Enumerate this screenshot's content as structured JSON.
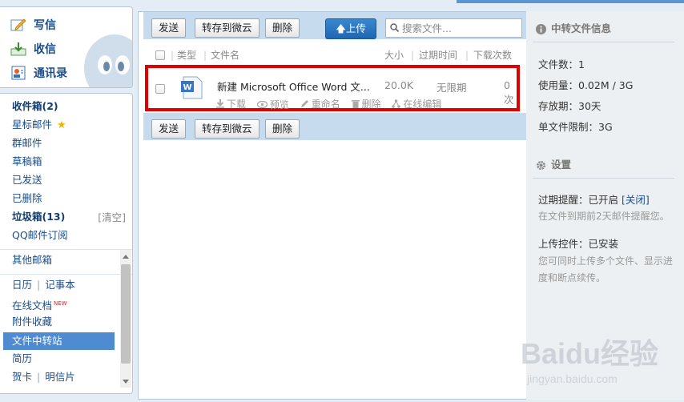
{
  "sidebar": {
    "write": "写信",
    "receive": "收信",
    "contacts": "通讯录",
    "inbox": "收件箱(2)",
    "starred": "星标邮件",
    "group": "群邮件",
    "drafts": "草稿箱",
    "sent": "已发送",
    "deleted": "已删除",
    "trash": "垃圾箱(13)",
    "clear": "[清空]",
    "subscription": "QQ邮件订阅",
    "other": "其他邮箱",
    "calendar": "日历",
    "notes": "记事本",
    "docs": "在线文档",
    "docs_badge": "NEW",
    "attachments": "附件收藏",
    "file_transfer": "文件中转站",
    "resume": "简历",
    "greeting": "贺卡",
    "postcard": "明信片"
  },
  "toolbar": {
    "send": "发送",
    "save_weiyun": "转存到微云",
    "delete": "删除",
    "upload": "上传",
    "search_placeholder": "搜索文件..."
  },
  "columns": {
    "type": "类型",
    "name": "文件名",
    "size": "大小",
    "expiry": "过期时间",
    "downloads": "下载次数"
  },
  "file": {
    "name": "新建 Microsoft Office Word 文...",
    "size": "20.0K",
    "expiry": "无限期",
    "downloads": "0次",
    "actions": {
      "download": "下载",
      "preview": "预览",
      "rename": "重命名",
      "delete": "删除",
      "edit_online": "在线编辑"
    }
  },
  "info": {
    "title": "中转文件信息",
    "file_count": "文件数：1",
    "usage": "使用量：0.02M / 3G",
    "storage": "存放期：30天",
    "limit": "单文件限制：3G",
    "settings_title": "设置",
    "expiry_reminder": "过期提醒：已开启",
    "close": "[关闭]",
    "reminder_note": "在文件到期前2天邮件提醒您。",
    "upload_control": "上传控件：已安装",
    "upload_note": "您可同时上传多个文件、显示进度和断点续传。"
  },
  "watermark": {
    "brand": "Baidu经验",
    "url": "jingyan.baidu.com"
  },
  "colors": {
    "accent": "#1f66b2",
    "highlight": "#e00000",
    "selected": "#4e8bd0"
  }
}
